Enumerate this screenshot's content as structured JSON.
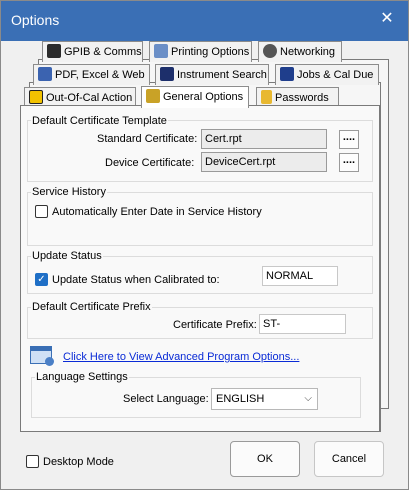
{
  "window": {
    "title": "Options",
    "close_glyph": "✕"
  },
  "tabs": {
    "row1": [
      {
        "label": "GPIB & Comms",
        "icon": "gpib-comms-icon"
      },
      {
        "label": "Printing Options",
        "icon": "printer-icon"
      },
      {
        "label": "Networking",
        "icon": "network-icon"
      }
    ],
    "row2": [
      {
        "label": "PDF, Excel & Web",
        "icon": "pdf-excel-web-icon"
      },
      {
        "label": "Instrument Search",
        "icon": "instrument-search-icon"
      },
      {
        "label": "Jobs & Cal Due",
        "icon": "jobs-cal-due-icon"
      }
    ],
    "row3": [
      {
        "label": "Out-Of-Cal Action",
        "icon": "warning-icon"
      },
      {
        "label": "General Options",
        "icon": "general-options-icon"
      },
      {
        "label": "Passwords",
        "icon": "lock-icon"
      }
    ],
    "active": "General Options"
  },
  "certificate_template": {
    "title": "Default Certificate Template",
    "standard_label": "Standard Certificate:",
    "standard_value": "Cert.rpt",
    "device_label": "Device Certificate:",
    "device_value": "DeviceCert.rpt",
    "browse_label": "...."
  },
  "service_history": {
    "title": "Service History",
    "auto_date_label": "Automatically Enter Date in Service History",
    "auto_date_checked": false
  },
  "update_status": {
    "title": "Update Status",
    "checkbox_label": "Update Status when Calibrated to:",
    "checked": true,
    "value": "NORMAL"
  },
  "certificate_prefix": {
    "title": "Default Certificate Prefix",
    "prefix_label": "Certificate Prefix:",
    "prefix_value": "ST-"
  },
  "advanced_link": {
    "label": "Click Here to View Advanced Program Options...",
    "icon": "advanced-options-icon"
  },
  "language": {
    "title": "Language Settings",
    "select_label": "Select Language:",
    "selected": "ENGLISH"
  },
  "footer": {
    "desktop_mode_label": "Desktop Mode",
    "desktop_mode_checked": false,
    "ok_label": "OK",
    "cancel_label": "Cancel"
  },
  "colors": {
    "titlebar": "#3a6fb5",
    "link": "#0a2bd6",
    "checkbox_checked": "#1f6fc6"
  }
}
